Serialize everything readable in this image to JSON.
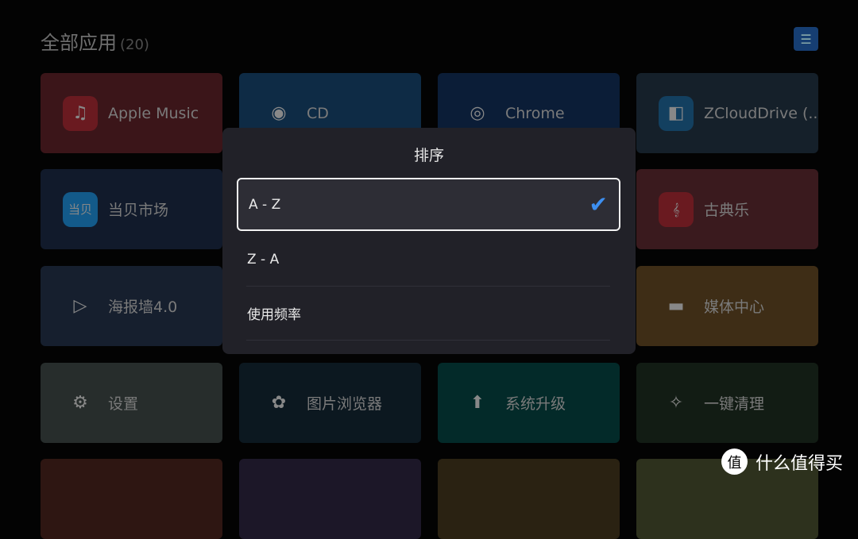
{
  "header": {
    "title": "全部应用",
    "count": "(20)",
    "sort_icon": "sort-list-icon"
  },
  "apps": [
    {
      "label": "Apple Music",
      "icon": "music-note-icon",
      "glyph": "♫",
      "bg": "#3b1519",
      "icbg": "#6a1a20"
    },
    {
      "label": "CD",
      "icon": "disc-icon",
      "glyph": "◉",
      "bg": "#0e2b45",
      "icbg": "transparent"
    },
    {
      "label": "Chrome",
      "icon": "chrome-icon",
      "glyph": "◎",
      "bg": "#0b1d37",
      "icbg": "transparent"
    },
    {
      "label": "ZCloudDrive (..",
      "icon": "zcloud-icon",
      "glyph": "◧",
      "bg": "#15202a",
      "icbg": "#134060"
    },
    {
      "label": "当贝市场",
      "icon": "dangbei-icon",
      "glyph": "当贝",
      "bg": "#111a2b",
      "icbg": "#135a8a"
    },
    {
      "label": "",
      "icon": "",
      "glyph": "",
      "bg": "#111a2b",
      "icbg": "transparent"
    },
    {
      "label": "",
      "icon": "",
      "glyph": "",
      "bg": "#111a2b",
      "icbg": "transparent"
    },
    {
      "label": "古典乐",
      "icon": "treble-clef-icon",
      "glyph": "𝄞",
      "bg": "#3a1a1e",
      "icbg": "#6a1a20"
    },
    {
      "label": "海报墙4.0",
      "icon": "film-play-icon",
      "glyph": "▷",
      "bg": "#161f2e",
      "icbg": "transparent"
    },
    {
      "label": "",
      "icon": "",
      "glyph": "",
      "bg": "#161f2e",
      "icbg": "transparent"
    },
    {
      "label": "",
      "icon": "",
      "glyph": "",
      "bg": "#161f2e",
      "icbg": "transparent"
    },
    {
      "label": "媒体中心",
      "icon": "folder-icon",
      "glyph": "▬",
      "bg": "#3e2d16",
      "icbg": "transparent"
    },
    {
      "label": "设置",
      "icon": "gear-icon",
      "glyph": "⚙",
      "bg": "#272d2c",
      "icbg": "transparent"
    },
    {
      "label": "图片浏览器",
      "icon": "photos-flower-icon",
      "glyph": "✿",
      "bg": "#0c1820",
      "icbg": "transparent"
    },
    {
      "label": "系统升级",
      "icon": "upgrade-arrow-icon",
      "glyph": "⬆",
      "bg": "#032a29",
      "icbg": "transparent"
    },
    {
      "label": "一键清理",
      "icon": "broom-icon",
      "glyph": "✧",
      "bg": "#121c14",
      "icbg": "transparent"
    },
    {
      "label": "",
      "icon": "",
      "glyph": "",
      "bg": "#2e1612",
      "icbg": "transparent"
    },
    {
      "label": "",
      "icon": "",
      "glyph": "",
      "bg": "#1c1728",
      "icbg": "transparent"
    },
    {
      "label": "",
      "icon": "",
      "glyph": "",
      "bg": "#2a2212",
      "icbg": "transparent"
    },
    {
      "label": "",
      "icon": "",
      "glyph": "",
      "bg": "#2d311d",
      "icbg": "transparent"
    }
  ],
  "dialog": {
    "title": "排序",
    "options": [
      {
        "label": "A - Z",
        "selected": true
      },
      {
        "label": "Z - A",
        "selected": false
      },
      {
        "label": "使用频率",
        "selected": false
      }
    ],
    "check_color": "#3d8ff0"
  },
  "watermark": {
    "logo": "值",
    "text": "什么值得买"
  }
}
